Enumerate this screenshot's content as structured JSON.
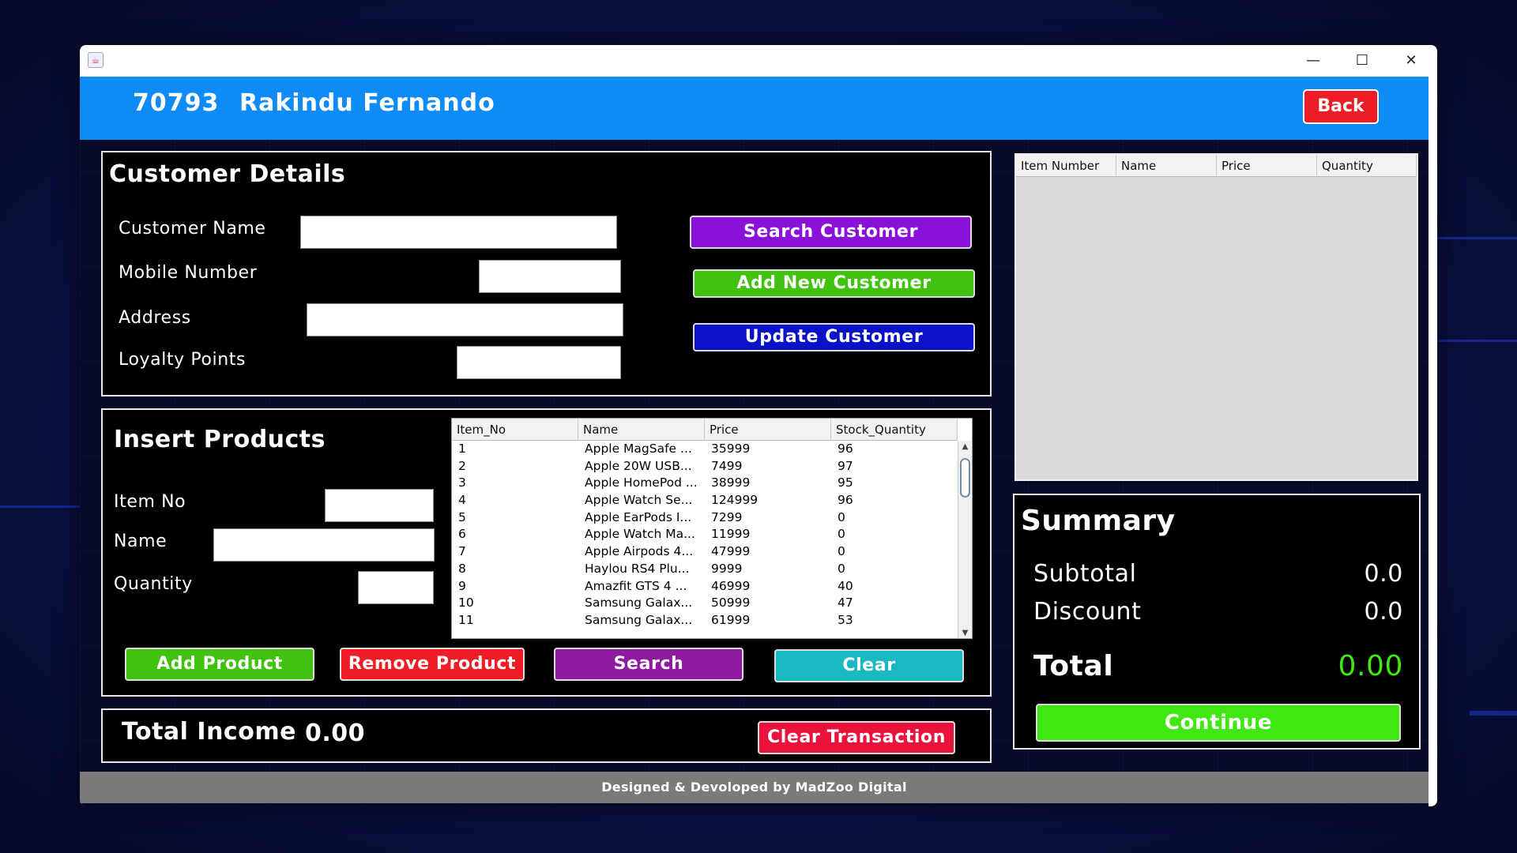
{
  "window": {
    "controls": {
      "minimize": "—",
      "maximize": "☐",
      "close": "✕"
    }
  },
  "header": {
    "user_id": "70793",
    "user_name": "Rakindu Fernando",
    "back_label": "Back"
  },
  "customer": {
    "title": "Customer Details",
    "name_label": "Customer Name",
    "mobile_label": "Mobile Number",
    "address_label": "Address",
    "loyalty_label": "Loyalty Points",
    "name_value": "",
    "mobile_value": "",
    "address_value": "",
    "loyalty_value": "",
    "search_label": "Search Customer",
    "add_label": "Add New Customer",
    "update_label": "Update Customer"
  },
  "products": {
    "title": "Insert Products",
    "item_no_label": "Item No",
    "name_label": "Name",
    "quantity_label": "Quantity",
    "item_no_value": "",
    "name_value": "",
    "quantity_value": "",
    "add_label": "Add Product",
    "remove_label": "Remove Product",
    "search_label": "Search",
    "clear_label": "Clear",
    "table": {
      "columns": [
        "Item_No",
        "Name",
        "Price",
        "Stock_Quantity"
      ],
      "rows": [
        [
          "1",
          "Apple MagSafe ...",
          "35999",
          "96"
        ],
        [
          "2",
          "Apple 20W USB...",
          "7499",
          "97"
        ],
        [
          "3",
          "Apple HomePod ...",
          "38999",
          "95"
        ],
        [
          "4",
          "Apple Watch Se...",
          "124999",
          "96"
        ],
        [
          "5",
          "Apple EarPods I...",
          "7299",
          "0"
        ],
        [
          "6",
          "Apple Watch Ma...",
          "11999",
          "0"
        ],
        [
          "7",
          "Apple Airpods 4...",
          "47999",
          "0"
        ],
        [
          "8",
          "Haylou RS4 Plu...",
          "9999",
          "0"
        ],
        [
          "9",
          "Amazfit GTS 4 ...",
          "46999",
          "40"
        ],
        [
          "10",
          "Samsung Galax...",
          "50999",
          "47"
        ],
        [
          "11",
          "Samsung Galax...",
          "61999",
          "53"
        ]
      ]
    }
  },
  "income": {
    "label": "Total Income",
    "value": "0.00",
    "clear_transaction_label": "Clear Transaction"
  },
  "cart": {
    "columns": [
      "Item Number",
      "Name",
      "Price",
      "Quantity"
    ],
    "rows": []
  },
  "summary": {
    "title": "Summary",
    "subtotal_label": "Subtotal",
    "subtotal_value": "0.0",
    "discount_label": "Discount",
    "discount_value": "0.0",
    "total_label": "Total",
    "total_value": "0.00",
    "continue_label": "Continue"
  },
  "footer": {
    "text": "Designed & Devoloped by MadZoo Digital"
  },
  "colors": {
    "header_blue": "#0f8bf7",
    "back_red": "#ee1c24",
    "search_purple": "#8a12d8",
    "add_green": "#40c20f",
    "update_blue": "#0a12c8",
    "remove_red": "#ee1c24",
    "search_product_purple": "#8e1aa0",
    "clear_teal": "#1ab8c0",
    "clear_transaction_red": "#e8123c",
    "continue_green": "#3fe812",
    "total_value_green": "#3fe812"
  }
}
